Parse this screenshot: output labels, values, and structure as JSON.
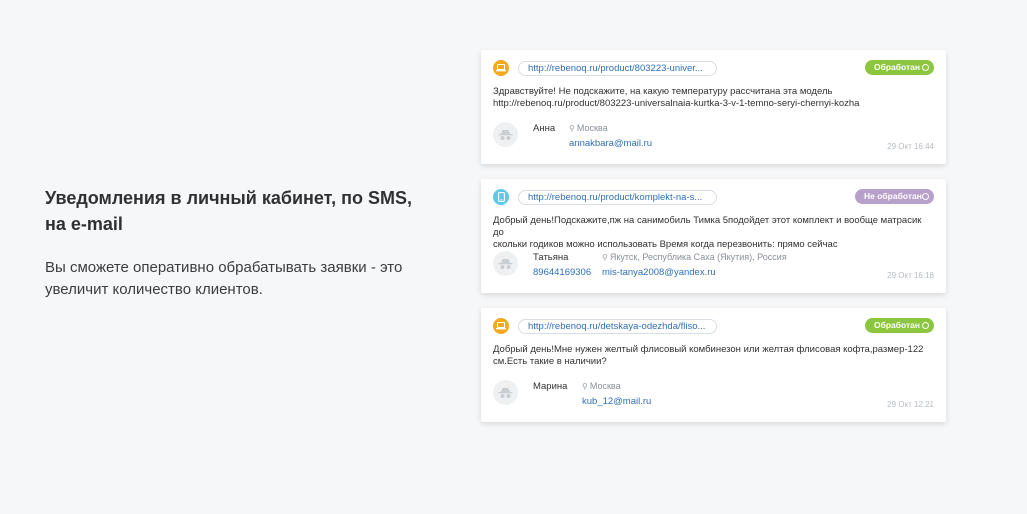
{
  "promo": {
    "title": "Уведомления в личный кабинет, по SMS, на e-mail",
    "description": "Вы сможете оперативно обрабатывать заявки - это увеличит количество клиентов."
  },
  "colors": {
    "processed": "#8cc63f",
    "unprocessed": "#b7a0c9",
    "desktop_icon": "#f4a81d",
    "mobile_icon": "#5fc8e6",
    "link": "#2f6fb8"
  },
  "requests": [
    {
      "icon": "laptop-icon",
      "url": "http://rebenoq.ru/product/803223-univer...",
      "status": "Обработан",
      "message_line1": "Здравствуйте! Не подскажите, на какую температуру рассчитана эта модель",
      "message_line2": "http://rebenoq.ru/product/803223-universalnaia-kurtka-3-v-1-temno-seryi-chernyi-kozha",
      "name": "Анна",
      "location": "Москва",
      "phone": "",
      "email": "annakbara@mail.ru",
      "time": "29 Окт 16:44"
    },
    {
      "icon": "smartphone-icon",
      "url": "http://rebenoq.ru/product/komplekt-na-s...",
      "status": "Не обработан",
      "message_line1": "Добрый день!Подскажите,пж на санимобиль Тимка 5подойдет этот комплект и вообще матрасик до",
      "message_line2": "скольки годиков можно использовать Время когда перезвонить: прямо сейчас",
      "name": "Татьяна",
      "location": "Якутск, Республика Саха (Якутия), Россия",
      "phone": "89644169306",
      "email": "mis-tanya2008@yandex.ru",
      "time": "29 Окт 16:18"
    },
    {
      "icon": "laptop-icon",
      "url": "http://rebenoq.ru/detskaya-odezhda/fliso...",
      "status": "Обработан",
      "message_line1": "Добрый день!Мне нужен желтый флисовый комбинезон или желтая флисовая кофта,размер-122",
      "message_line2": "см.Есть такие в наличии?",
      "name": "Марина",
      "location": "Москва",
      "phone": "",
      "email": "kub_12@mail.ru",
      "time": "29 Окт 12:21"
    }
  ]
}
